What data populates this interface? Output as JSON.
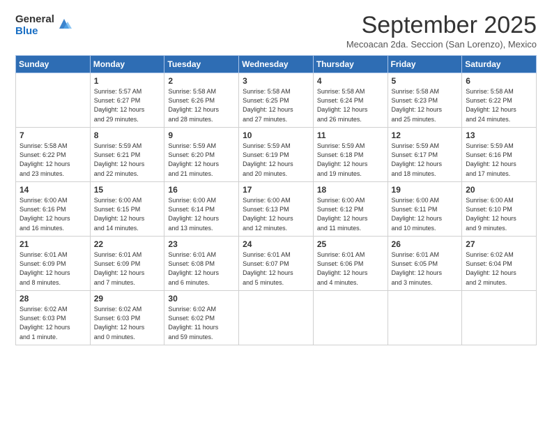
{
  "logo": {
    "general": "General",
    "blue": "Blue"
  },
  "header": {
    "title": "September 2025",
    "subtitle": "Mecoacan 2da. Seccion (San Lorenzo), Mexico"
  },
  "weekdays": [
    "Sunday",
    "Monday",
    "Tuesday",
    "Wednesday",
    "Thursday",
    "Friday",
    "Saturday"
  ],
  "weeks": [
    [
      {
        "day": "",
        "info": ""
      },
      {
        "day": "1",
        "info": "Sunrise: 5:57 AM\nSunset: 6:27 PM\nDaylight: 12 hours\nand 29 minutes."
      },
      {
        "day": "2",
        "info": "Sunrise: 5:58 AM\nSunset: 6:26 PM\nDaylight: 12 hours\nand 28 minutes."
      },
      {
        "day": "3",
        "info": "Sunrise: 5:58 AM\nSunset: 6:25 PM\nDaylight: 12 hours\nand 27 minutes."
      },
      {
        "day": "4",
        "info": "Sunrise: 5:58 AM\nSunset: 6:24 PM\nDaylight: 12 hours\nand 26 minutes."
      },
      {
        "day": "5",
        "info": "Sunrise: 5:58 AM\nSunset: 6:23 PM\nDaylight: 12 hours\nand 25 minutes."
      },
      {
        "day": "6",
        "info": "Sunrise: 5:58 AM\nSunset: 6:22 PM\nDaylight: 12 hours\nand 24 minutes."
      }
    ],
    [
      {
        "day": "7",
        "info": "Sunrise: 5:58 AM\nSunset: 6:22 PM\nDaylight: 12 hours\nand 23 minutes."
      },
      {
        "day": "8",
        "info": "Sunrise: 5:59 AM\nSunset: 6:21 PM\nDaylight: 12 hours\nand 22 minutes."
      },
      {
        "day": "9",
        "info": "Sunrise: 5:59 AM\nSunset: 6:20 PM\nDaylight: 12 hours\nand 21 minutes."
      },
      {
        "day": "10",
        "info": "Sunrise: 5:59 AM\nSunset: 6:19 PM\nDaylight: 12 hours\nand 20 minutes."
      },
      {
        "day": "11",
        "info": "Sunrise: 5:59 AM\nSunset: 6:18 PM\nDaylight: 12 hours\nand 19 minutes."
      },
      {
        "day": "12",
        "info": "Sunrise: 5:59 AM\nSunset: 6:17 PM\nDaylight: 12 hours\nand 18 minutes."
      },
      {
        "day": "13",
        "info": "Sunrise: 5:59 AM\nSunset: 6:16 PM\nDaylight: 12 hours\nand 17 minutes."
      }
    ],
    [
      {
        "day": "14",
        "info": "Sunrise: 6:00 AM\nSunset: 6:16 PM\nDaylight: 12 hours\nand 16 minutes."
      },
      {
        "day": "15",
        "info": "Sunrise: 6:00 AM\nSunset: 6:15 PM\nDaylight: 12 hours\nand 14 minutes."
      },
      {
        "day": "16",
        "info": "Sunrise: 6:00 AM\nSunset: 6:14 PM\nDaylight: 12 hours\nand 13 minutes."
      },
      {
        "day": "17",
        "info": "Sunrise: 6:00 AM\nSunset: 6:13 PM\nDaylight: 12 hours\nand 12 minutes."
      },
      {
        "day": "18",
        "info": "Sunrise: 6:00 AM\nSunset: 6:12 PM\nDaylight: 12 hours\nand 11 minutes."
      },
      {
        "day": "19",
        "info": "Sunrise: 6:00 AM\nSunset: 6:11 PM\nDaylight: 12 hours\nand 10 minutes."
      },
      {
        "day": "20",
        "info": "Sunrise: 6:00 AM\nSunset: 6:10 PM\nDaylight: 12 hours\nand 9 minutes."
      }
    ],
    [
      {
        "day": "21",
        "info": "Sunrise: 6:01 AM\nSunset: 6:09 PM\nDaylight: 12 hours\nand 8 minutes."
      },
      {
        "day": "22",
        "info": "Sunrise: 6:01 AM\nSunset: 6:09 PM\nDaylight: 12 hours\nand 7 minutes."
      },
      {
        "day": "23",
        "info": "Sunrise: 6:01 AM\nSunset: 6:08 PM\nDaylight: 12 hours\nand 6 minutes."
      },
      {
        "day": "24",
        "info": "Sunrise: 6:01 AM\nSunset: 6:07 PM\nDaylight: 12 hours\nand 5 minutes."
      },
      {
        "day": "25",
        "info": "Sunrise: 6:01 AM\nSunset: 6:06 PM\nDaylight: 12 hours\nand 4 minutes."
      },
      {
        "day": "26",
        "info": "Sunrise: 6:01 AM\nSunset: 6:05 PM\nDaylight: 12 hours\nand 3 minutes."
      },
      {
        "day": "27",
        "info": "Sunrise: 6:02 AM\nSunset: 6:04 PM\nDaylight: 12 hours\nand 2 minutes."
      }
    ],
    [
      {
        "day": "28",
        "info": "Sunrise: 6:02 AM\nSunset: 6:03 PM\nDaylight: 12 hours\nand 1 minute."
      },
      {
        "day": "29",
        "info": "Sunrise: 6:02 AM\nSunset: 6:03 PM\nDaylight: 12 hours\nand 0 minutes."
      },
      {
        "day": "30",
        "info": "Sunrise: 6:02 AM\nSunset: 6:02 PM\nDaylight: 11 hours\nand 59 minutes."
      },
      {
        "day": "",
        "info": ""
      },
      {
        "day": "",
        "info": ""
      },
      {
        "day": "",
        "info": ""
      },
      {
        "day": "",
        "info": ""
      }
    ]
  ]
}
